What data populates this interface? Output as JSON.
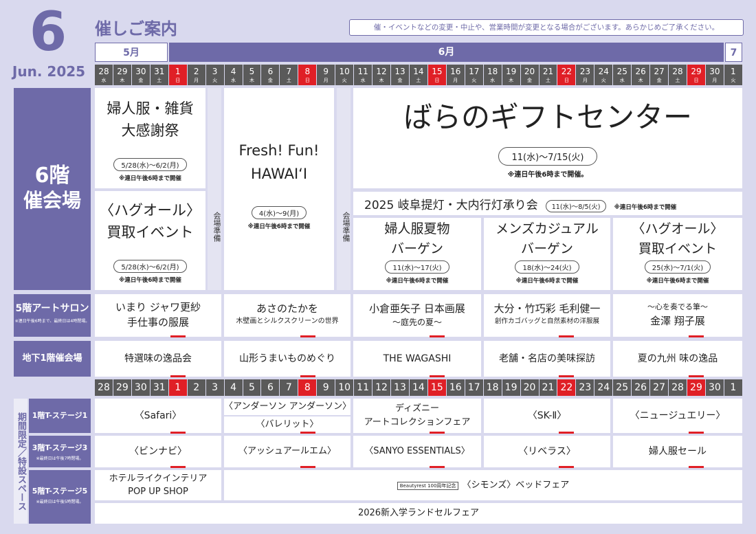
{
  "header": {
    "month_num": "6",
    "month_en": "Jun. 2025",
    "title": "催しご案内",
    "notice": "催・イベントなどの変更・中止や、営業時間が変更となる場合がございます。あらかじめご了承ください。"
  },
  "months": {
    "may": "5月",
    "jun": "6月",
    "jul": "7月"
  },
  "days": [
    {
      "d": "28",
      "w": "水"
    },
    {
      "d": "29",
      "w": "木"
    },
    {
      "d": "30",
      "w": "金"
    },
    {
      "d": "31",
      "w": "土"
    },
    {
      "d": "1",
      "w": "日",
      "red": true
    },
    {
      "d": "2",
      "w": "月"
    },
    {
      "d": "3",
      "w": "火"
    },
    {
      "d": "4",
      "w": "水"
    },
    {
      "d": "5",
      "w": "木"
    },
    {
      "d": "6",
      "w": "金"
    },
    {
      "d": "7",
      "w": "土"
    },
    {
      "d": "8",
      "w": "日",
      "red": true
    },
    {
      "d": "9",
      "w": "月"
    },
    {
      "d": "10",
      "w": "火"
    },
    {
      "d": "11",
      "w": "水"
    },
    {
      "d": "12",
      "w": "木"
    },
    {
      "d": "13",
      "w": "金"
    },
    {
      "d": "14",
      "w": "土"
    },
    {
      "d": "15",
      "w": "日",
      "red": true
    },
    {
      "d": "16",
      "w": "月"
    },
    {
      "d": "17",
      "w": "火"
    },
    {
      "d": "18",
      "w": "水"
    },
    {
      "d": "19",
      "w": "木"
    },
    {
      "d": "20",
      "w": "金"
    },
    {
      "d": "21",
      "w": "土"
    },
    {
      "d": "22",
      "w": "日",
      "red": true
    },
    {
      "d": "23",
      "w": "月"
    },
    {
      "d": "24",
      "w": "火"
    },
    {
      "d": "25",
      "w": "水"
    },
    {
      "d": "26",
      "w": "木"
    },
    {
      "d": "27",
      "w": "金"
    },
    {
      "d": "28",
      "w": "土"
    },
    {
      "d": "29",
      "w": "日",
      "red": true
    },
    {
      "d": "30",
      "w": "月"
    },
    {
      "d": "1",
      "w": "火"
    }
  ],
  "floor6": {
    "label_a": "6階",
    "label_b": "催会場",
    "ev1": {
      "l1": "婦人服・雑貨",
      "l2": "大感謝祭",
      "date": "5/28(水)～6/2(月)",
      "note": "※連日午後6時まで開催"
    },
    "ev2": {
      "l1": "〈ハグオール〉",
      "l2": "買取イベント",
      "date": "5/28(水)～6/2(月)",
      "note": "※連日午後6時まで開催"
    },
    "prep": "会場準備",
    "ev3": {
      "l1": "Fresh! Fun!",
      "l2": "HAWAI‘I",
      "date": "4(水)～9(月)",
      "note": "※連日午後6時まで開催"
    },
    "ev4": {
      "title": "ばらのギフトセンター",
      "date": "11(水)～7/15(火)",
      "note": "※連日午後6時まで開催。"
    },
    "ev5": {
      "title": "2025 岐阜提灯・大内行灯承り会",
      "date": "11(水)～8/5(火)",
      "note": "※連日午後6時まで開催"
    },
    "ev6": {
      "l1": "婦人服夏物",
      "l2": "バーゲン",
      "date": "11(水)～17(火)",
      "note": "※連日午後6時まで開催"
    },
    "ev7": {
      "l1": "メンズカジュアル",
      "l2": "バーゲン",
      "date": "18(水)～24(火)",
      "note": "※連日午後6時まで開催"
    },
    "ev8": {
      "l1": "〈ハグオール〉",
      "l2": "買取イベント",
      "date": "25(水)～7/1(火)",
      "note": "※連日午後6時まで開催"
    }
  },
  "floor5": {
    "label": "5階アートサロン",
    "sub": "※連日午後6時まで、最終日は4時閉場。",
    "items": [
      {
        "l1": "いまり ジャワ更紗",
        "l2": "手仕事の服展"
      },
      {
        "l1": "あさのたかを",
        "l2": "木壁画とシルクスクリーンの世界"
      },
      {
        "l1": "小倉亜矢子 日本画展",
        "l2": "～庭先の夏～"
      },
      {
        "l1": "大分・竹巧彩 毛利健一",
        "l2": "創作カゴバッグと自然素材の洋服展"
      },
      {
        "l1": "～心を奏でる筆～",
        "l2": "金澤 翔子展"
      }
    ]
  },
  "b1": {
    "label": "地下1階催会場",
    "items": [
      "特選味の逸品会",
      "山形うまいものめぐり",
      "THE WAGASHI",
      "老舗・名店の美味探訪",
      "夏の九州 味の逸品"
    ]
  },
  "special": {
    "side": "期間限定／特設スペース",
    "s1": {
      "label": "1階T-ステージ1",
      "items": [
        "〈Safari〉",
        "〈アンダーソン アンダーソン〉",
        "〈バレリット〉",
        "ディズニー",
        "アートコレクションフェア",
        "〈SK-Ⅱ〉",
        "〈ニュージュエリー〉"
      ]
    },
    "s3": {
      "label": "3階T-ステージ3",
      "sub": "※最終日は午後7時閉場。",
      "items": [
        "〈ビンナビ〉",
        "〈アッシュアールエム〉",
        "〈SANYO ESSENTIALS〉",
        "〈リベラス〉",
        "婦人服セール"
      ]
    },
    "s5": {
      "label": "5階T-ステージ5",
      "sub": "※最終日は午後5時閉場。",
      "items": [
        "ホテルライクインテリア",
        "POP UP SHOP",
        "Beautyrest 100周年記念",
        "〈シモンズ〉ベッドフェア",
        "2026新入学ランドセルフェア"
      ]
    }
  }
}
